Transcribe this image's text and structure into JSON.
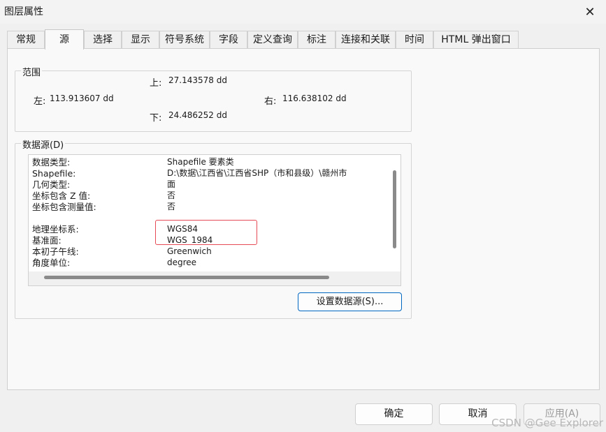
{
  "window": {
    "title": "图层属性",
    "close_icon": "close-icon"
  },
  "tabs": [
    {
      "label": "常规"
    },
    {
      "label": "源",
      "active": true
    },
    {
      "label": "选择"
    },
    {
      "label": "显示"
    },
    {
      "label": "符号系统"
    },
    {
      "label": "字段"
    },
    {
      "label": "定义查询"
    },
    {
      "label": "标注"
    },
    {
      "label": "连接和关联"
    },
    {
      "label": "时间"
    },
    {
      "label": "HTML 弹出窗口"
    }
  ],
  "extent": {
    "legend": "范围",
    "top_label": "上:",
    "top_value": "27.143578 dd",
    "left_label": "左:",
    "left_value": "113.913607 dd",
    "right_label": "右:",
    "right_value": "116.638102 dd",
    "bottom_label": "下:",
    "bottom_value": "24.486252 dd"
  },
  "datasource": {
    "legend": "数据源(D)",
    "rows": [
      {
        "label": "数据类型:",
        "value": "Shapefile 要素类"
      },
      {
        "label": "Shapefile:",
        "value": "D:\\数据\\江西省\\江西省SHP（市和县级）\\赣州市"
      },
      {
        "label": "几何类型:",
        "value": "面"
      },
      {
        "label": "坐标包含 Z 值:",
        "value": "否"
      },
      {
        "label": "坐标包含测量值:",
        "value": "否"
      },
      {
        "label": "地理坐标系:",
        "value": "WGS84"
      },
      {
        "label": "基准面:",
        "value": "WGS_1984"
      },
      {
        "label": "本初子午线:",
        "value": "Greenwich"
      },
      {
        "label": "角度单位:",
        "value": "degree"
      }
    ],
    "set_button": "设置数据源(S)..."
  },
  "footer": {
    "ok": "确定",
    "cancel": "取消",
    "apply": "应用(A)"
  },
  "watermark": "CSDN @Gee Explorer",
  "colors": {
    "highlight_box": "#e64a55",
    "primary_border": "#0067c0"
  }
}
